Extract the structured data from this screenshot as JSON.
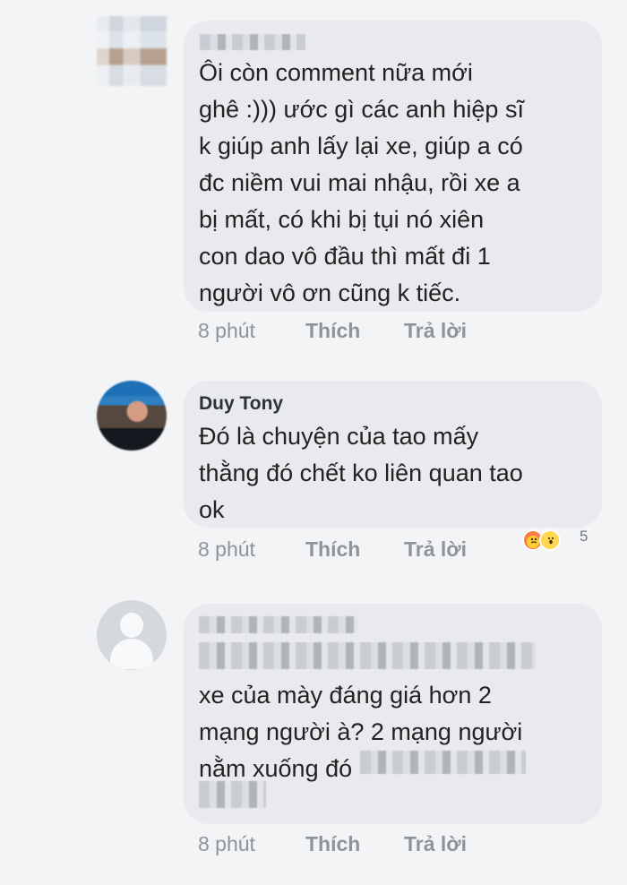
{
  "comments": [
    {
      "author": "",
      "text": "Ôi còn comment nữa mới\nghê :))) ước gì các anh hiệp sĩ\nk giúp anh lấy lại xe, giúp a có\nđc niềm vui mai nhậu, rồi xe a\nbị mất, có khi bị tụi nó xiên\ncon dao vô đầu thì mất đi 1\nngười vô ơn cũng k tiếc.",
      "time": "8 phút",
      "like": "Thích",
      "reply": "Trả lời"
    },
    {
      "author": "Duy Tony",
      "text": "Đó là chuyện của tao mấy\nthằng đó chết ko liên quan tao\nok",
      "time": "8 phút",
      "like": "Thích",
      "reply": "Trả lời",
      "reaction_count": "5"
    },
    {
      "author": "",
      "text": "xe của mày đáng giá hơn 2\nmạng người à? 2 mạng người\nnằm xuống đó",
      "time": "8 phút",
      "like": "Thích",
      "reply": "Trả lời"
    }
  ],
  "icons": {
    "reaction_1": "angry-reaction-icon",
    "reaction_2": "wow-reaction-icon"
  },
  "colors": {
    "background": "#f3f4f6",
    "bubble": "#e8eaee",
    "meta_text": "#8f949b"
  }
}
